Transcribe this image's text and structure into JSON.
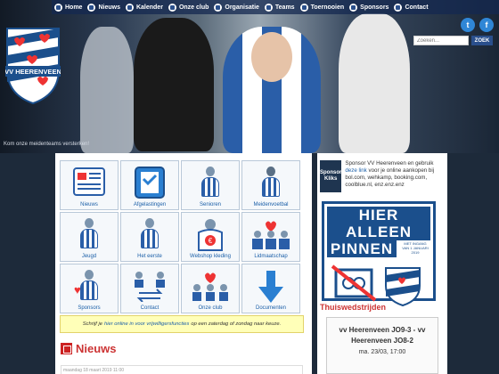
{
  "nav": {
    "items": [
      {
        "label": "Home",
        "icon": "home-icon"
      },
      {
        "label": "Nieuws",
        "icon": "news-icon"
      },
      {
        "label": "Kalender",
        "icon": "calendar-icon"
      },
      {
        "label": "Onze club",
        "icon": "club-icon"
      },
      {
        "label": "Organisatie",
        "icon": "organisation-icon"
      },
      {
        "label": "Teams",
        "icon": "teams-icon"
      },
      {
        "label": "Toernooien",
        "icon": "tournament-icon"
      },
      {
        "label": "Sponsors",
        "icon": "sponsor-icon"
      },
      {
        "label": "Contact",
        "icon": "contact-icon"
      }
    ]
  },
  "logo": {
    "text": "VV HEERENVEEN"
  },
  "social": {
    "twitter": "t",
    "facebook": "f"
  },
  "search": {
    "placeholder": "Zoeken...",
    "button": "ZOEK"
  },
  "hero": {
    "caption": "Kom onze meidenteams versterken!"
  },
  "tiles": [
    {
      "label": "Nieuws",
      "icon": "news-icon"
    },
    {
      "label": "Afgelastingen",
      "icon": "cancellation-icon"
    },
    {
      "label": "Senioren",
      "icon": "senior-player-icon"
    },
    {
      "label": "Meidenvoetbal",
      "icon": "girls-football-icon"
    },
    {
      "label": "Jeugd",
      "icon": "youth-player-icon"
    },
    {
      "label": "Het eerste",
      "icon": "first-team-icon"
    },
    {
      "label": "Webshop kleding",
      "icon": "webshop-icon"
    },
    {
      "label": "Lidmaatschap",
      "icon": "membership-icon"
    },
    {
      "label": "Sponsors",
      "icon": "sponsors-heart-icon"
    },
    {
      "label": "Contact",
      "icon": "contact-arrows-icon"
    },
    {
      "label": "Onze club",
      "icon": "club-hearts-icon"
    },
    {
      "label": "Documenten",
      "icon": "download-arrow-icon"
    }
  ],
  "notice": {
    "before": "Schrijf je",
    "link": "hier online in voor vrijwilligersfuncties",
    "after": "op een zaterdag of zondag naar keuze."
  },
  "news": {
    "title": "Nieuws",
    "item_date": "maandag 18 maart 2019 11:00"
  },
  "sponsor": {
    "logo_line1": "Sponsor",
    "logo_line2": "Kliks",
    "text_before": "Sponsor VV Heerenveen en gebruik",
    "link": "deze link",
    "text_after": "voor je online aankopen bij bol.com, wehkamp, booking.com, coolblue.nl, enz.enz.enz"
  },
  "banner": {
    "line1": "HIER ALLEEN",
    "line2": "PINNEN",
    "note": "MET INGANG VAN 1 JANUARI 2019"
  },
  "thuiswedstrijden": {
    "title": "Thuiswedstrijden",
    "team1": "vv Heerenveen JO9-3 - vv",
    "team2": "Heerenveen JO8-2",
    "date": "ma. 23/03, 17:00"
  },
  "colors": {
    "brand_blue": "#1b4f8c",
    "accent_red": "#cc3333",
    "link": "#1b5fa8"
  }
}
